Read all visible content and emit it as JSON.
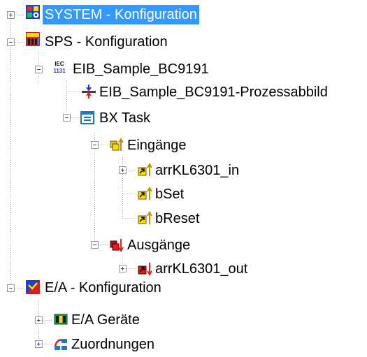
{
  "tree": {
    "system": {
      "label": "SYSTEM - Konfiguration",
      "icon": "system-config-icon",
      "expanded": false,
      "selected": true
    },
    "sps": {
      "label": "SPS - Konfiguration",
      "icon": "plc-config-icon",
      "expanded": true
    },
    "eib_sample": {
      "label": "EIB_Sample_BC9191",
      "icon": "iec-project-icon",
      "expanded": true
    },
    "process_image": {
      "label": "EIB_Sample_BC9191-Prozessabbild",
      "icon": "process-image-icon"
    },
    "bx_task": {
      "label": "BX Task",
      "icon": "task-icon",
      "expanded": true
    },
    "inputs": {
      "label": "Eingänge",
      "icon": "inputs-icon",
      "expanded": true
    },
    "arrKL6301_in": {
      "label": "arrKL6301_in",
      "icon": "input-variable-icon",
      "expanded": false
    },
    "bSet": {
      "label": "bSet",
      "icon": "input-variable-icon"
    },
    "bReset": {
      "label": "bReset",
      "icon": "input-variable-icon"
    },
    "outputs": {
      "label": "Ausgänge",
      "icon": "outputs-icon",
      "expanded": true
    },
    "arrKL6301_out": {
      "label": "arrKL6301_out",
      "icon": "output-variable-icon",
      "expanded": false
    },
    "io_config": {
      "label": "E/A - Konfiguration",
      "icon": "io-config-icon",
      "expanded": true
    },
    "io_devices": {
      "label": "E/A Geräte",
      "icon": "io-devices-icon",
      "expanded": false
    },
    "mappings": {
      "label": "Zuordnungen",
      "icon": "mappings-icon",
      "expanded": false
    }
  },
  "colors": {
    "selection": "#3399ff",
    "tree_line": "#a0a0a0"
  }
}
